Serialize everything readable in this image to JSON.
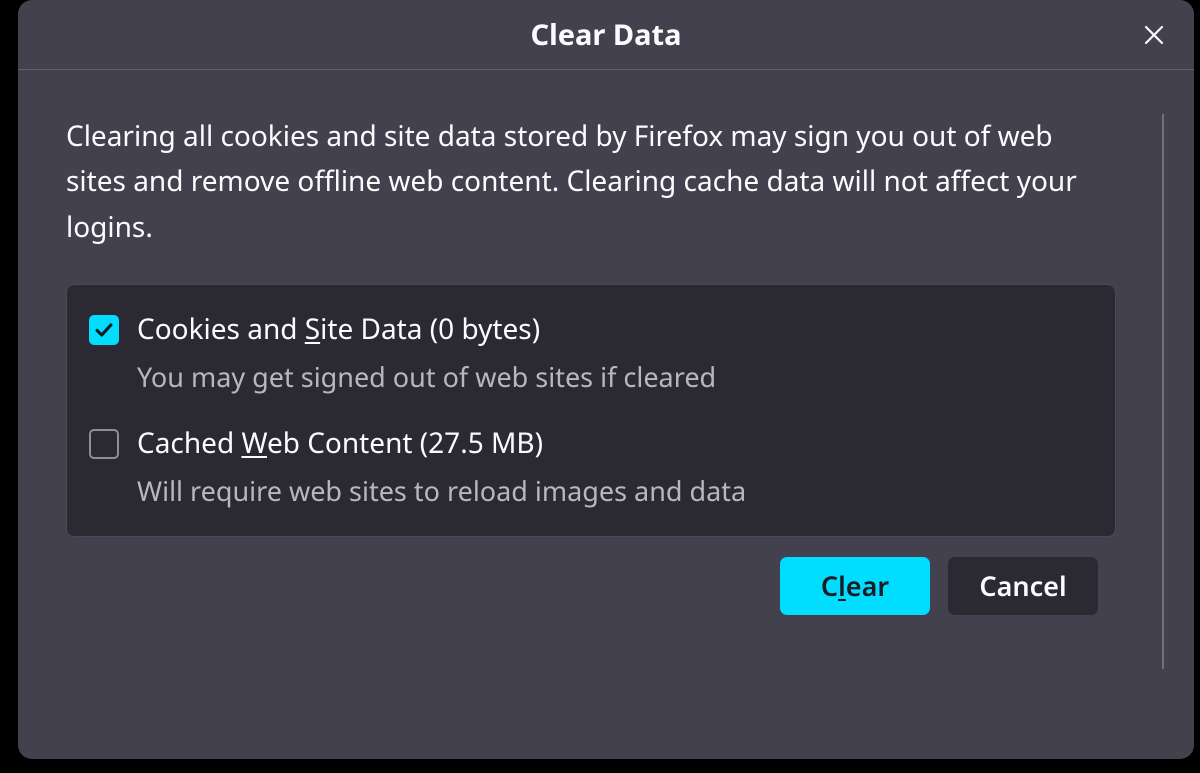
{
  "dialog": {
    "title": "Clear Data",
    "description": "Clearing all cookies and site data stored by Firefox may sign you out of web sites and remove offline web content. Clearing cache data will not affect your logins."
  },
  "options": [
    {
      "checked": true,
      "label_pre": "Cookies and ",
      "label_u": "S",
      "label_post": "ite Data (0 bytes)",
      "sub": "You may get signed out of web sites if cleared"
    },
    {
      "checked": false,
      "label_pre": "Cached ",
      "label_u": "W",
      "label_post": "eb Content (27.5 MB)",
      "sub": "Will require web sites to reload images and data"
    }
  ],
  "buttons": {
    "clear_pre": "C",
    "clear_u": "l",
    "clear_post": "ear",
    "cancel": "Cancel"
  }
}
